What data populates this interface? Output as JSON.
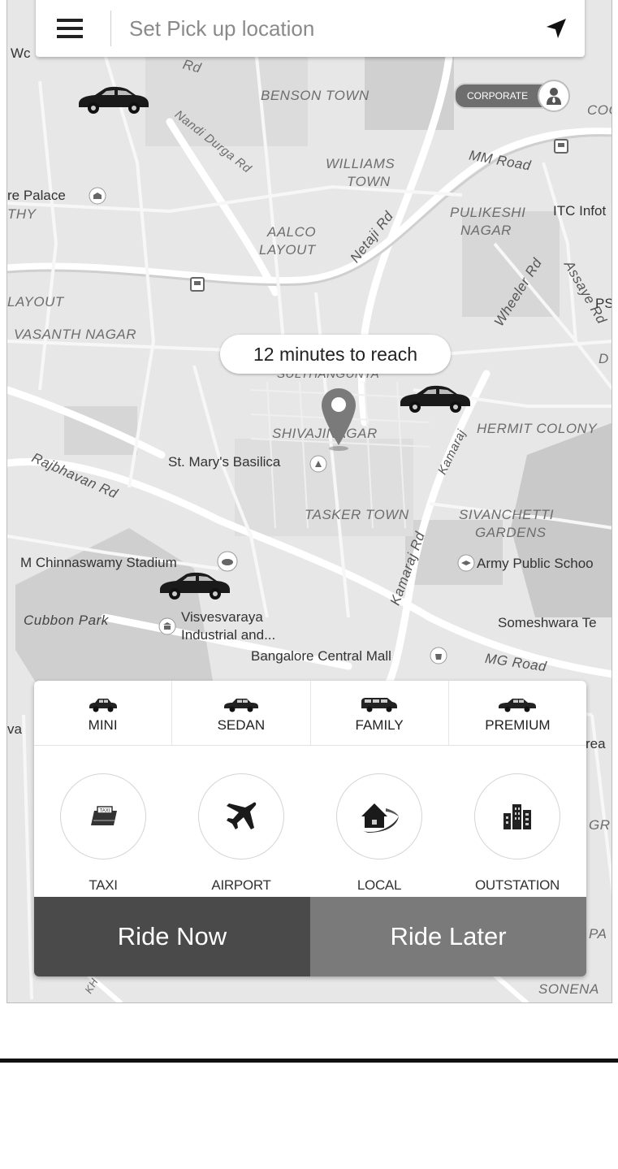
{
  "search": {
    "placeholder": "Set Pick up location"
  },
  "corporate": {
    "label": "CORPORATE"
  },
  "eta": "12 minutes to reach",
  "map_labels": {
    "wc": "Wc",
    "rd_top": "Rd",
    "benson_town": "BENSON TOWN",
    "nandi_durga_rd": "Nandi Durga Rd",
    "williams_town_1": "WILLIAMS",
    "williams_town_2": "TOWN",
    "mm_road": "MM Road",
    "palace": "re Palace",
    "thy": "THY",
    "aalco_1": "AALCO",
    "aalco_2": "LAYOUT",
    "netaji_rd": "Netaji Rd",
    "pulikeshi_1": "PULIKESHI",
    "pulikeshi_2": "NAGAR",
    "itc": "ITC Infot",
    "layout": "LAYOUT",
    "vasanth": "VASANTH NAGAR",
    "wheeler": "Wheeler Rd",
    "assaye": "Assaye Rd",
    "ps": "PS",
    "d": "D",
    "coc": "COC",
    "sulthan": "SULTHANGUNTA",
    "shivaji": "SHIVAJINAGAR",
    "hermit": "HERMIT COLONY",
    "rajbhavan": "Rajbhavan Rd",
    "st_marys": "St. Mary's Basilica",
    "kamaraj_1": "Kamaraj",
    "tasker": "TASKER TOWN",
    "sivanchetti_1": "SIVANCHETTI",
    "sivanchetti_2": "GARDENS",
    "chinnaswamy": "M Chinnaswamy Stadium",
    "army": "Army Public Schoo",
    "kamaraj_2": "Kamaraj Rd",
    "cubbon": "Cubbon Park",
    "visvesvaraya_1": "Visvesvaraya",
    "visvesvaraya_2": "Industrial and...",
    "someshwara": "Someshwara Te",
    "central_mall": "Bangalore Central Mall",
    "mg_road": "MG Road",
    "va": "va",
    "rea": "rea",
    "gr": "GR",
    "pa": "PA",
    "sonena": "SONENA",
    "kh": "KH"
  },
  "vehicle_types": [
    {
      "label": "MINI"
    },
    {
      "label": "SEDAN"
    },
    {
      "label": "FAMILY"
    },
    {
      "label": "PREMIUM"
    }
  ],
  "services": [
    {
      "label": "TAXI",
      "icon": "taxi-icon"
    },
    {
      "label": "AIRPORT",
      "icon": "airplane-icon"
    },
    {
      "label": "LOCAL",
      "icon": "house-icon"
    },
    {
      "label": "OUTSTATION",
      "icon": "buildings-icon"
    }
  ],
  "actions": {
    "ride_now": "Ride Now",
    "ride_later": "Ride Later"
  }
}
